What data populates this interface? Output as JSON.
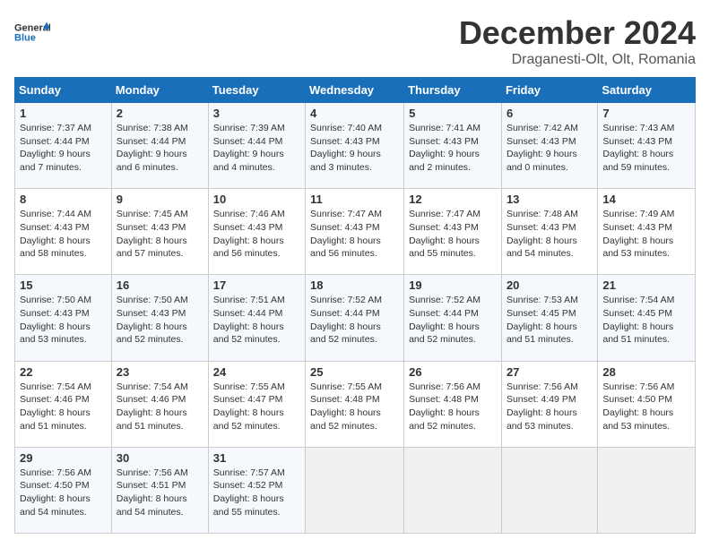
{
  "header": {
    "logo_general": "General",
    "logo_blue": "Blue",
    "month_title": "December 2024",
    "subtitle": "Draganesti-Olt, Olt, Romania"
  },
  "weekdays": [
    "Sunday",
    "Monday",
    "Tuesday",
    "Wednesday",
    "Thursday",
    "Friday",
    "Saturday"
  ],
  "weeks": [
    [
      {
        "day": "1",
        "sunrise": "7:37 AM",
        "sunset": "4:44 PM",
        "daylight": "9 hours and 7 minutes."
      },
      {
        "day": "2",
        "sunrise": "7:38 AM",
        "sunset": "4:44 PM",
        "daylight": "9 hours and 6 minutes."
      },
      {
        "day": "3",
        "sunrise": "7:39 AM",
        "sunset": "4:44 PM",
        "daylight": "9 hours and 4 minutes."
      },
      {
        "day": "4",
        "sunrise": "7:40 AM",
        "sunset": "4:43 PM",
        "daylight": "9 hours and 3 minutes."
      },
      {
        "day": "5",
        "sunrise": "7:41 AM",
        "sunset": "4:43 PM",
        "daylight": "9 hours and 2 minutes."
      },
      {
        "day": "6",
        "sunrise": "7:42 AM",
        "sunset": "4:43 PM",
        "daylight": "9 hours and 0 minutes."
      },
      {
        "day": "7",
        "sunrise": "7:43 AM",
        "sunset": "4:43 PM",
        "daylight": "8 hours and 59 minutes."
      }
    ],
    [
      {
        "day": "8",
        "sunrise": "7:44 AM",
        "sunset": "4:43 PM",
        "daylight": "8 hours and 58 minutes."
      },
      {
        "day": "9",
        "sunrise": "7:45 AM",
        "sunset": "4:43 PM",
        "daylight": "8 hours and 57 minutes."
      },
      {
        "day": "10",
        "sunrise": "7:46 AM",
        "sunset": "4:43 PM",
        "daylight": "8 hours and 56 minutes."
      },
      {
        "day": "11",
        "sunrise": "7:47 AM",
        "sunset": "4:43 PM",
        "daylight": "8 hours and 56 minutes."
      },
      {
        "day": "12",
        "sunrise": "7:47 AM",
        "sunset": "4:43 PM",
        "daylight": "8 hours and 55 minutes."
      },
      {
        "day": "13",
        "sunrise": "7:48 AM",
        "sunset": "4:43 PM",
        "daylight": "8 hours and 54 minutes."
      },
      {
        "day": "14",
        "sunrise": "7:49 AM",
        "sunset": "4:43 PM",
        "daylight": "8 hours and 53 minutes."
      }
    ],
    [
      {
        "day": "15",
        "sunrise": "7:50 AM",
        "sunset": "4:43 PM",
        "daylight": "8 hours and 53 minutes."
      },
      {
        "day": "16",
        "sunrise": "7:50 AM",
        "sunset": "4:43 PM",
        "daylight": "8 hours and 52 minutes."
      },
      {
        "day": "17",
        "sunrise": "7:51 AM",
        "sunset": "4:44 PM",
        "daylight": "8 hours and 52 minutes."
      },
      {
        "day": "18",
        "sunrise": "7:52 AM",
        "sunset": "4:44 PM",
        "daylight": "8 hours and 52 minutes."
      },
      {
        "day": "19",
        "sunrise": "7:52 AM",
        "sunset": "4:44 PM",
        "daylight": "8 hours and 52 minutes."
      },
      {
        "day": "20",
        "sunrise": "7:53 AM",
        "sunset": "4:45 PM",
        "daylight": "8 hours and 51 minutes."
      },
      {
        "day": "21",
        "sunrise": "7:54 AM",
        "sunset": "4:45 PM",
        "daylight": "8 hours and 51 minutes."
      }
    ],
    [
      {
        "day": "22",
        "sunrise": "7:54 AM",
        "sunset": "4:46 PM",
        "daylight": "8 hours and 51 minutes."
      },
      {
        "day": "23",
        "sunrise": "7:54 AM",
        "sunset": "4:46 PM",
        "daylight": "8 hours and 51 minutes."
      },
      {
        "day": "24",
        "sunrise": "7:55 AM",
        "sunset": "4:47 PM",
        "daylight": "8 hours and 52 minutes."
      },
      {
        "day": "25",
        "sunrise": "7:55 AM",
        "sunset": "4:48 PM",
        "daylight": "8 hours and 52 minutes."
      },
      {
        "day": "26",
        "sunrise": "7:56 AM",
        "sunset": "4:48 PM",
        "daylight": "8 hours and 52 minutes."
      },
      {
        "day": "27",
        "sunrise": "7:56 AM",
        "sunset": "4:49 PM",
        "daylight": "8 hours and 53 minutes."
      },
      {
        "day": "28",
        "sunrise": "7:56 AM",
        "sunset": "4:50 PM",
        "daylight": "8 hours and 53 minutes."
      }
    ],
    [
      {
        "day": "29",
        "sunrise": "7:56 AM",
        "sunset": "4:50 PM",
        "daylight": "8 hours and 54 minutes."
      },
      {
        "day": "30",
        "sunrise": "7:56 AM",
        "sunset": "4:51 PM",
        "daylight": "8 hours and 54 minutes."
      },
      {
        "day": "31",
        "sunrise": "7:57 AM",
        "sunset": "4:52 PM",
        "daylight": "8 hours and 55 minutes."
      },
      null,
      null,
      null,
      null
    ]
  ],
  "labels": {
    "sunrise": "Sunrise:",
    "sunset": "Sunset:",
    "daylight": "Daylight:"
  }
}
